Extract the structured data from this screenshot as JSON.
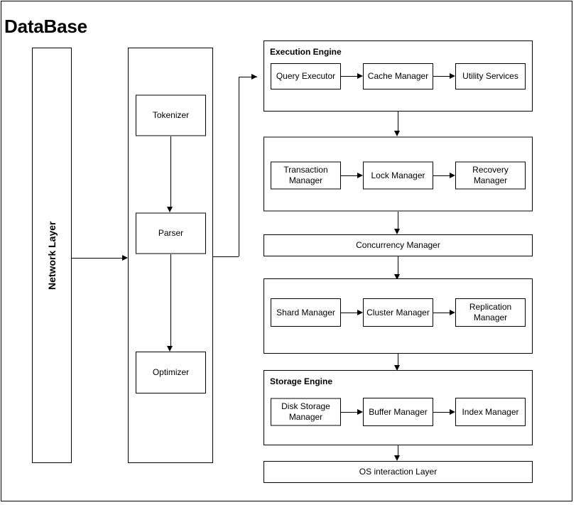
{
  "diagram": {
    "title": "DataBase",
    "network_layer": {
      "label": "Network Layer"
    },
    "query_processor": {
      "boxes": [
        {
          "label": "Tokenizer"
        },
        {
          "label": "Parser"
        },
        {
          "label": "Optimizer"
        }
      ]
    },
    "groups": [
      {
        "id": "execution-engine",
        "label": "Execution Engine",
        "boxes": [
          {
            "label": "Query Executor"
          },
          {
            "label": "Cache Manager"
          },
          {
            "label": "Utility Services"
          }
        ]
      },
      {
        "id": "transaction-group",
        "label": "",
        "boxes": [
          {
            "label": "Transaction Manager"
          },
          {
            "label": "Lock Manager"
          },
          {
            "label": "Recovery Manager"
          }
        ]
      },
      {
        "id": "distribution-group",
        "label": "",
        "boxes": [
          {
            "label": "Shard Manager"
          },
          {
            "label": "Cluster Manager"
          },
          {
            "label": "Replication Manager"
          }
        ]
      },
      {
        "id": "storage-engine",
        "label": "Storage Engine",
        "boxes": [
          {
            "label": "Disk Storage Manager"
          },
          {
            "label": "Buffer Manager"
          },
          {
            "label": "Index Manager"
          }
        ]
      }
    ],
    "concurrency_manager": {
      "label": "Concurrency Manager"
    },
    "os_interaction_layer": {
      "label": "OS interaction Layer"
    },
    "colors": {
      "stroke": "#000000",
      "shadow": "#808080",
      "background": "#ffffff"
    }
  },
  "chart_data": {
    "type": "diagram",
    "title": "DataBase",
    "nodes": [
      "Network Layer",
      "Tokenizer",
      "Parser",
      "Optimizer",
      "Query Executor",
      "Cache Manager",
      "Utility Services",
      "Transaction Manager",
      "Lock Manager",
      "Recovery Manager",
      "Concurrency Manager",
      "Shard Manager",
      "Cluster Manager",
      "Replication Manager",
      "Disk Storage Manager",
      "Buffer Manager",
      "Index Manager",
      "OS interaction Layer"
    ],
    "edges": [
      [
        "Network Layer",
        "Query Processor"
      ],
      [
        "Tokenizer",
        "Parser"
      ],
      [
        "Parser",
        "Optimizer"
      ],
      [
        "Query Processor",
        "Query Executor"
      ],
      [
        "Query Executor",
        "Cache Manager"
      ],
      [
        "Cache Manager",
        "Utility Services"
      ],
      [
        "Execution Engine",
        "Transaction Manager"
      ],
      [
        "Transaction Manager",
        "Lock Manager"
      ],
      [
        "Lock Manager",
        "Recovery Manager"
      ],
      [
        "Transaction Group",
        "Concurrency Manager"
      ],
      [
        "Concurrency Manager",
        "Shard Manager"
      ],
      [
        "Shard Manager",
        "Cluster Manager"
      ],
      [
        "Cluster Manager",
        "Replication Manager"
      ],
      [
        "Distribution Group",
        "Storage Engine"
      ],
      [
        "Disk Storage Manager",
        "Buffer Manager"
      ],
      [
        "Buffer Manager",
        "Index Manager"
      ],
      [
        "Storage Engine",
        "OS interaction Layer"
      ]
    ]
  }
}
